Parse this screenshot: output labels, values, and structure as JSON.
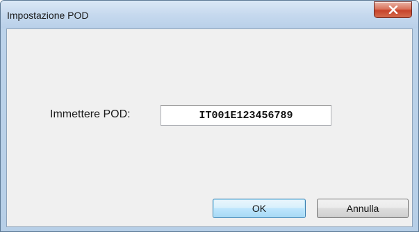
{
  "window": {
    "title": "Impostazione POD"
  },
  "form": {
    "pod_label": "Immettere POD:",
    "pod_value": "IT001E123456789"
  },
  "buttons": {
    "ok_label": "OK",
    "cancel_label": "Annulla"
  },
  "icons": {
    "close": "close-icon"
  },
  "colors": {
    "client_background": "#f0f0f0",
    "close_button": "#c6432a",
    "default_button_border": "#3c7fb1"
  }
}
